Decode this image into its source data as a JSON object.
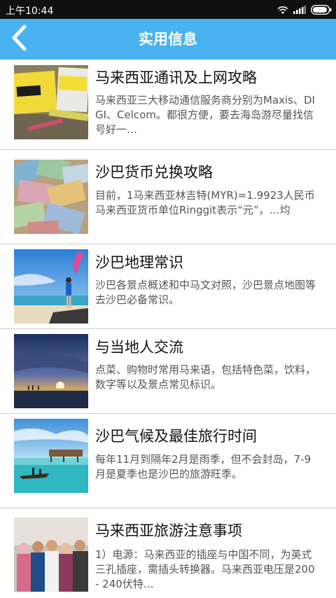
{
  "status_bar": {
    "time": "上午10:44"
  },
  "header": {
    "title": "实用信息",
    "back_icon": "chevron-left-icon"
  },
  "colors": {
    "header_bg": "#4ab2f0",
    "status_bar_bg": "#101010",
    "divider": "#cfcfcf"
  },
  "items": [
    {
      "title": "马来西亚通讯及上网攻略",
      "desc": "马来西亚三大移动通信服务商分别为Maxis、DIGI、Celcom。都很方便，要去海岛游尽量找信号好一…",
      "thumb": "sim-cards-photo"
    },
    {
      "title": "沙巴货币兑换攻略",
      "desc": "目前，1马来西亚林吉特(MYR)=1.9923人民币 马来西亚货币单位Ringgit表示“元”，…均",
      "thumb": "banknotes-photo"
    },
    {
      "title": "沙巴地理常识",
      "desc": "沙巴各景点概述和中马文对照，沙巴景点地图等去沙巴必备常识。",
      "thumb": "beach-photo"
    },
    {
      "title": "与当地人交流",
      "desc": "点菜、购物时常用马来语，包括特色菜，饮料，数字等以及景点常见标识。",
      "thumb": "sunset-photo"
    },
    {
      "title": "沙巴气候及最佳旅行时间",
      "desc": "每年11月到隔年2月是雨季，但不会封岛，7-9月是夏季也是沙巴的旅游旺季。",
      "thumb": "sea-village-photo"
    },
    {
      "title": "马来西亚旅游注意事项",
      "desc": "1）电源：马来西亚的插座与中国不同，为英式三孔插座，需插头转换器。马来西亚电压是200 - 240伏特…",
      "thumb": "people-photo"
    }
  ]
}
